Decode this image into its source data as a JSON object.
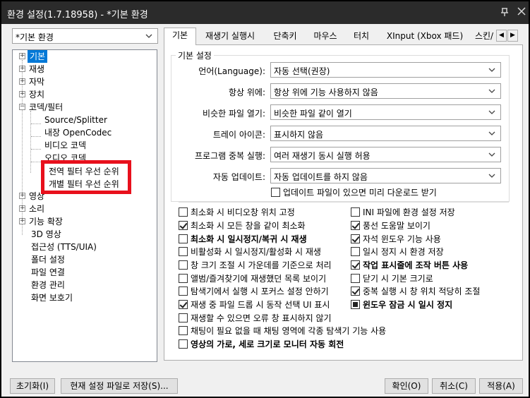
{
  "window": {
    "title": "환경 설정(1.7.18958) - *기본 환경",
    "pin_icon": "pin-icon",
    "close_icon": "close-icon"
  },
  "preset": {
    "value": "*기본 환경"
  },
  "tree": {
    "items": [
      {
        "label": "기본",
        "selected": true
      },
      {
        "label": "재생"
      },
      {
        "label": "자막"
      },
      {
        "label": "장치"
      },
      {
        "label": "코덱/필터",
        "expanded": true
      },
      {
        "label": "Source/Splitter"
      },
      {
        "label": "내장 OpenCodec"
      },
      {
        "label": "비디오 코덱"
      },
      {
        "label": "오디오 코덱"
      },
      {
        "label": "영상"
      },
      {
        "label": "소리"
      },
      {
        "label": "기능 확장"
      },
      {
        "label": "3D 영상"
      },
      {
        "label": "접근성 (TTS/UIA)"
      },
      {
        "label": "폴더 설정"
      },
      {
        "label": "파일 연결"
      },
      {
        "label": "환경 관리"
      },
      {
        "label": "화면 보호기"
      }
    ],
    "highlight": {
      "line1": "전역 필터 우선 순위",
      "line2": "개별 필터 우선 순위",
      "color": "#e8101c"
    }
  },
  "tabs": [
    {
      "label": "기본",
      "active": true
    },
    {
      "label": "재생기 실행시"
    },
    {
      "label": "단축키"
    },
    {
      "label": "마우스"
    },
    {
      "label": "터치"
    },
    {
      "label": "XInput (Xbox 패드)"
    },
    {
      "label": "스킨/"
    }
  ],
  "basic": {
    "group_title": "기본 설정",
    "fields": [
      {
        "label": "언어(Language):",
        "value": "자동 선택(권장)"
      },
      {
        "label": "항상 위에:",
        "value": "항상 위에 기능 사용하지 않음"
      },
      {
        "label": "비슷한 파일 열기:",
        "value": "비슷한 파일 같이 열기"
      },
      {
        "label": "트레이 아이콘:",
        "value": "표시하지 않음"
      },
      {
        "label": "프로그램 중복 실행:",
        "value": "여러 재생기 동시 실행 허용"
      },
      {
        "label": "자동 업데이트:",
        "value": "자동 업데이트를 하지 않음"
      }
    ],
    "update_download": {
      "label": "업데이트 파일이 있으면 미리 다운로드 받기",
      "checked": false
    }
  },
  "options_left": [
    {
      "label": "최소화 시 비디오창 위치 고정",
      "state": "unchecked"
    },
    {
      "label": "최소화 시 모든 창을 같이 최소화",
      "state": "checked"
    },
    {
      "label": "최소화 시 일시정지/복귀 시 재생",
      "state": "unchecked",
      "bold": true
    },
    {
      "label": "비활성화 시 일시정지/활성화 시 재생",
      "state": "unchecked"
    },
    {
      "label": "창 크기 조절 시 가운데를 기준으로 처리",
      "state": "unchecked"
    },
    {
      "label": "앨범/즐겨찾기에 재생했던 목록 보이기",
      "state": "unchecked"
    },
    {
      "label": "탐색기에서 실행 시 포커스 설정 안하기",
      "state": "unchecked"
    },
    {
      "label": "재생 중 파일 드롭 시 동작 선택 UI 표시",
      "state": "checked"
    },
    {
      "label": "재생할 수 있으면 오류 창 표시하지 않기",
      "state": "unchecked"
    },
    {
      "label": "채팅이 필요 없을 때 채팅 영역에 각종 탐색기 기능 사용",
      "state": "unchecked"
    },
    {
      "label": "영상의 가로, 세로 크기로 모니터 자동 회전",
      "state": "unchecked",
      "bold": true
    }
  ],
  "options_right": [
    {
      "label": "INI 파일에 환경 설정 저장",
      "state": "unchecked"
    },
    {
      "label": "풍선 도움말 보이기",
      "state": "checked"
    },
    {
      "label": "자석 윈도우 기능 사용",
      "state": "checked"
    },
    {
      "label": "일시 정지 시 환경 저장",
      "state": "unchecked"
    },
    {
      "label": "작업 표시줄에 조작 버튼 사용",
      "state": "checked",
      "bold": true
    },
    {
      "label": "닫기 시 기본 크기로",
      "state": "unchecked"
    },
    {
      "label": "중복 실행 시 창 위치 적당히 조절",
      "state": "checked"
    },
    {
      "label": "윈도우 잠금 시 일시 정지",
      "state": "indeterminate",
      "bold": true
    }
  ],
  "buttons": {
    "reset": "초기화(I)",
    "save_current": "현재 설정 파일로 저장(S)...",
    "ok": "확인(O)",
    "cancel": "취소(C)",
    "apply": "적용(A)"
  }
}
